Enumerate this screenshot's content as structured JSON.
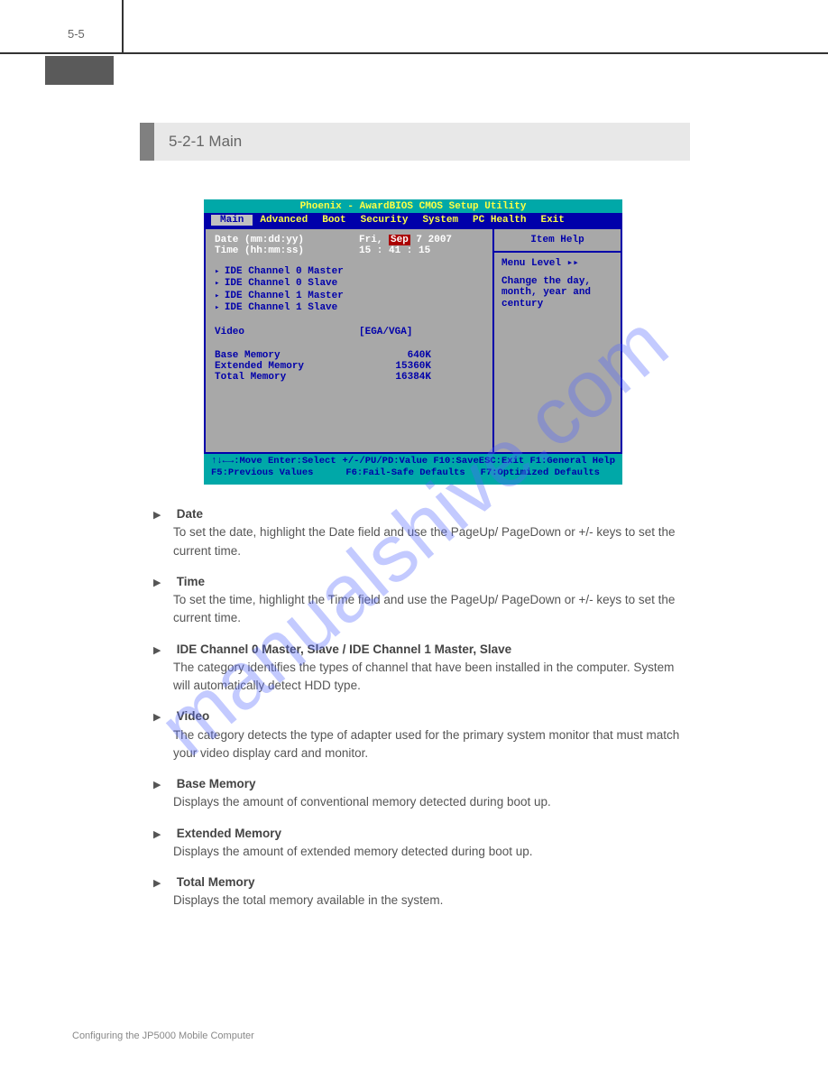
{
  "page_number": "5-5",
  "section_title": "5-2-1 Main",
  "watermark": "manualshive.com",
  "bios": {
    "title": "Phoenix - AwardBIOS CMOS Setup Utility",
    "menu": [
      "Main",
      "Advanced",
      "Boot",
      "Security",
      "System",
      "PC Health",
      "Exit"
    ],
    "fields": {
      "date_label": "Date (mm:dd:yy)",
      "date_val_prefix": "Fri, ",
      "date_val_sel": "Sep",
      "date_val_suffix": " 7 2007",
      "time_label": "Time (hh:mm:ss)",
      "time_val": "15 : 41 : 15",
      "ide0m": "IDE Channel 0 Master",
      "ide0s": "IDE Channel 0 Slave",
      "ide1m": "IDE Channel 1 Master",
      "ide1s": "IDE Channel 1 Slave",
      "video_label": "Video",
      "video_val": "[EGA/VGA]",
      "base_label": "Base Memory",
      "base_val": "640K",
      "ext_label": "Extended Memory",
      "ext_val": "15360K",
      "tot_label": "Total Memory",
      "tot_val": "16384K"
    },
    "help": {
      "title": "Item Help",
      "level": "Menu Level   ▸▸",
      "text": "Change the day, month, year and century"
    },
    "footer": {
      "r1a": "↑↓←→:Move  Enter:Select",
      "r1b": "+/-/PU/PD:Value  F10:Save",
      "r1c": "ESC:Exit  F1:General Help",
      "r2a": "F5:Previous Values",
      "r2b": "F6:Fail-Safe Defaults",
      "r2c": "F7:Optimized Defaults"
    }
  },
  "items": [
    {
      "label": "Date",
      "desc": "To set the date, highlight the Date field and use the PageUp/ PageDown or +/- keys to set the current time."
    },
    {
      "label": "Time",
      "desc": "To set the time, highlight the Time field and use the PageUp/ PageDown or +/- keys to set the current time."
    },
    {
      "label": "IDE Channel 0 Master, Slave / IDE Channel 1 Master, Slave",
      "desc": "The category identifies the types of channel that have been installed in the computer. System will automatically detect HDD type."
    },
    {
      "label": "Video",
      "desc": "The category detects the type of adapter used for the primary system monitor that must match your video display card and monitor."
    },
    {
      "label": "Base Memory",
      "desc": "Displays the amount of conventional memory detected during boot up."
    },
    {
      "label": "Extended Memory",
      "desc": "Displays the amount of extended memory detected during boot up."
    },
    {
      "label": "Total Memory",
      "desc": "Displays the total memory available in the system."
    }
  ],
  "footer": "Configuring the JP5000 Mobile Computer"
}
